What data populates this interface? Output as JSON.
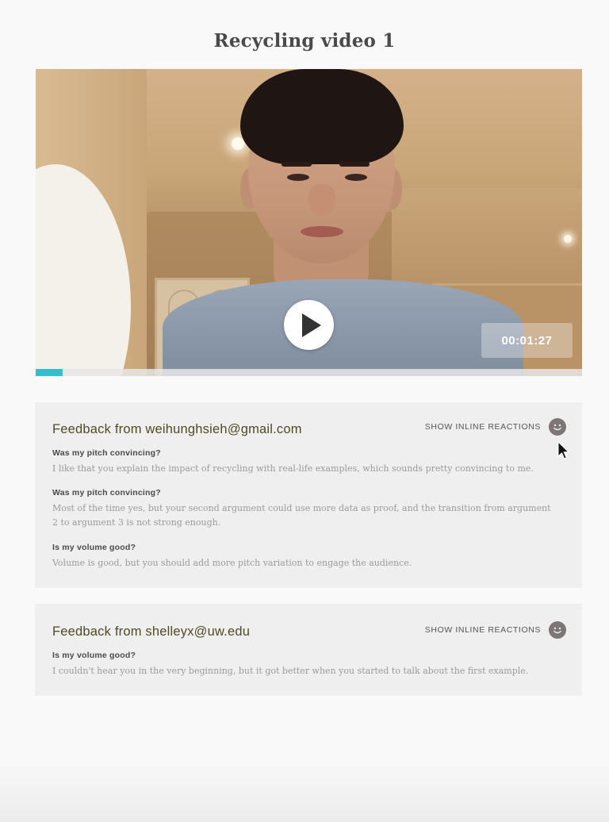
{
  "page": {
    "title": "Recycling video 1"
  },
  "video": {
    "timestamp": "00:01:27",
    "progress_percent": 5,
    "accent_color": "#33c0cc",
    "play_icon": "play-icon"
  },
  "feedback": [
    {
      "title": "Feedback from weihunghsieh@gmail.com",
      "reactions_label": "SHOW INLINE REACTIONS",
      "reactions_icon": "smiley-icon",
      "items": [
        {
          "question": "Was my pitch convincing?",
          "answer": "I like that you explain the impact of recycling with real-life examples, which sounds pretty convincing to me."
        },
        {
          "question": "Was my pitch convincing?",
          "answer": "Most of the time yes, but your second argument could use more data as proof, and the transition from argument 2 to argument 3 is not strong enough."
        },
        {
          "question": "Is my volume good?",
          "answer": "Volume is good, but you should add more pitch variation to engage the audience."
        }
      ]
    },
    {
      "title": "Feedback from shelleyx@uw.edu",
      "reactions_label": "SHOW INLINE REACTIONS",
      "reactions_icon": "smiley-icon",
      "items": [
        {
          "question": "Is my volume good?",
          "answer": "I couldn't hear you in the very beginning, but it got better when you started to talk about the first example."
        }
      ]
    }
  ]
}
